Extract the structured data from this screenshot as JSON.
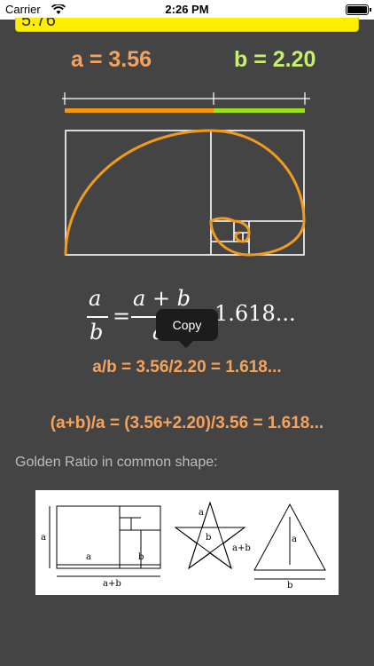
{
  "status_bar": {
    "carrier": "Carrier",
    "time": "2:26 PM"
  },
  "input": {
    "value": "5.76"
  },
  "values": {
    "a_label": "a = 3.56",
    "b_label": "b = 2.20"
  },
  "formula": {
    "a": "a",
    "b": "b",
    "a_plus_b": "a + b",
    "den_a": "a",
    "equals": "=",
    "phi": "1.618..."
  },
  "tooltip": {
    "label": "Copy"
  },
  "ratios": {
    "line1": "a/b = 3.56/2.20 = 1.618...",
    "line2": "(a+b)/a = (3.56+2.20)/3.56 = 1.618..."
  },
  "section": {
    "label": "Golden Ratio in common shape:"
  },
  "shape_labels": {
    "rect_a_side": "a",
    "rect_a_bottom": "a",
    "rect_b_bottom": "b",
    "rect_ab": "a+b",
    "star_a": "a",
    "star_b": "b",
    "star_ab": "a+b",
    "tri_a": "a",
    "tri_b": "b"
  },
  "colors": {
    "background": "#444444",
    "a_color": "#f5a35c",
    "b_color": "#c8ef70",
    "bar_a": "#f0960f",
    "bar_b": "#99e01a",
    "spiral": "#f29a1d",
    "input_bg": "#ffee00"
  },
  "icons": [
    "wifi-icon",
    "battery-icon"
  ]
}
